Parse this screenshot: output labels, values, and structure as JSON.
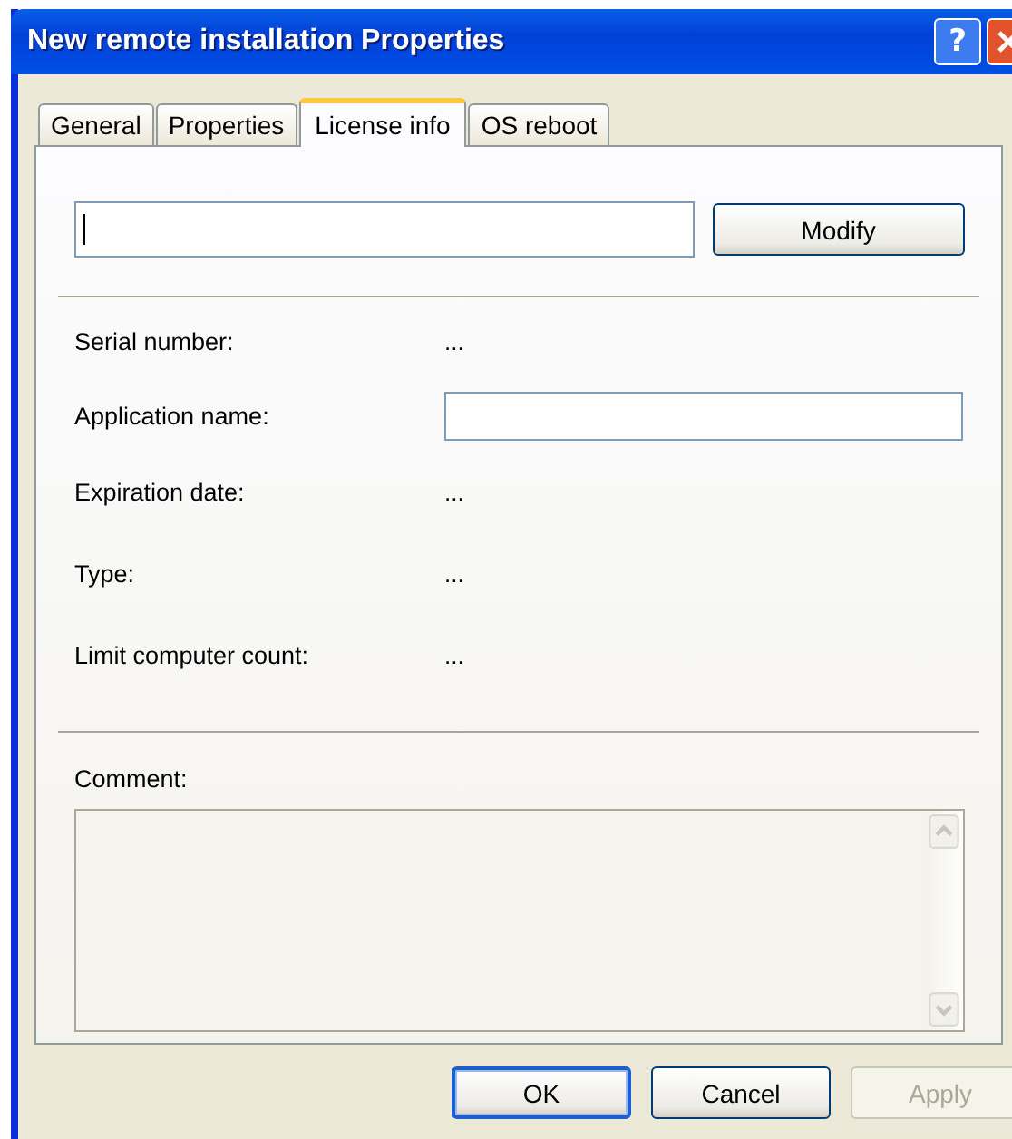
{
  "window": {
    "title": "New remote installation Properties",
    "help_button": "?"
  },
  "tabs": [
    {
      "label": "General",
      "selected": false
    },
    {
      "label": "Properties",
      "selected": false
    },
    {
      "label": "License info",
      "selected": true
    },
    {
      "label": "OS reboot",
      "selected": false
    }
  ],
  "license_field": {
    "focused": true
  },
  "modify_button": "Modify",
  "fields": [
    {
      "kind": "text",
      "label": "Serial number:",
      "value": "..."
    },
    {
      "kind": "input",
      "label": "Application name:"
    },
    {
      "kind": "text",
      "label": "Expiration date:",
      "value": "..."
    },
    {
      "kind": "text",
      "label": "Type:",
      "value": "..."
    },
    {
      "kind": "text",
      "label": "Limit computer count:",
      "value": "..."
    }
  ],
  "comment": {
    "label": "Comment:",
    "disabled": true
  },
  "buttons": [
    {
      "label": "OK",
      "default": true,
      "disabled": false
    },
    {
      "label": "Cancel",
      "default": false,
      "disabled": false
    },
    {
      "label": "Apply",
      "default": false,
      "disabled": true
    }
  ]
}
